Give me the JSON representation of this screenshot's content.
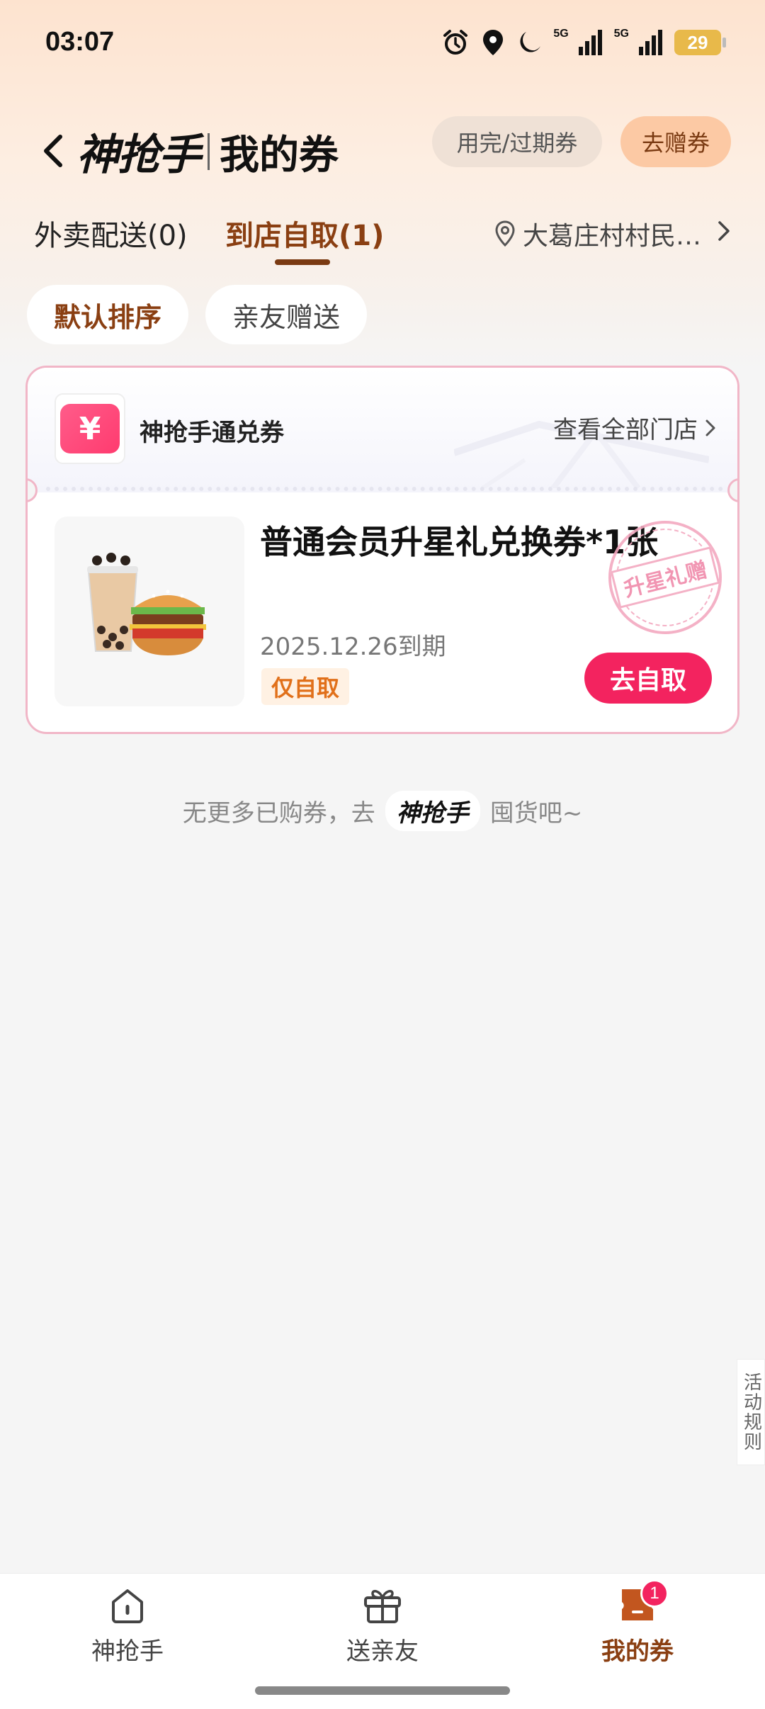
{
  "status_bar": {
    "time": "03:07",
    "battery": "29",
    "network_1": "5G",
    "network_2": "5G"
  },
  "nav": {
    "brand": "神抢手",
    "title": "我的券",
    "expired_button": "用完/过期券",
    "gift_button": "去赠券"
  },
  "tabs": {
    "delivery": "外卖配送(0)",
    "pickup": "到店自取(1)",
    "location": "大葛庄村村民…"
  },
  "filters": {
    "default_sort": "默认排序",
    "friend_gift": "亲友赠送"
  },
  "coupon": {
    "icon_symbol": "¥",
    "name": "神抢手通兑券",
    "all_stores": "查看全部门店",
    "title": "普通会员升星礼兑换券*1张",
    "expiry": "2025.12.26到期",
    "tag": "仅自取",
    "action": "去自取",
    "stamp": "升星礼赠"
  },
  "footer_note": {
    "prefix": "无更多已购券，去",
    "brand": "神抢手",
    "suffix": "囤货吧~"
  },
  "side_rules": "活动规则",
  "bottom_nav": {
    "home": "神抢手",
    "gift": "送亲友",
    "mine": "我的券",
    "mine_badge": "1"
  },
  "colors": {
    "accent_brown": "#8a3f12",
    "primary_pink": "#f3235f",
    "orange_tag": "#e1701a"
  }
}
